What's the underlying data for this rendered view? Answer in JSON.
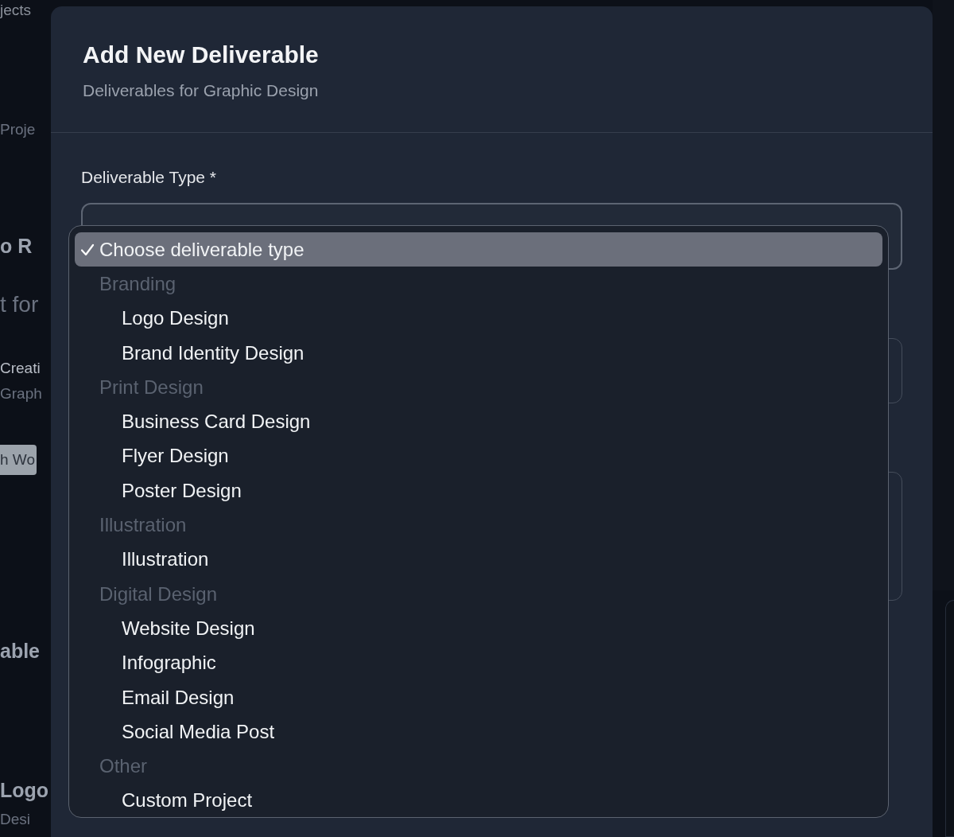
{
  "background": {
    "fragments": [
      {
        "text": "jects",
        "kind": "nav"
      },
      {
        "text": "Proje",
        "kind": "muted"
      },
      {
        "text": "o R",
        "kind": "heading"
      },
      {
        "text": "t for",
        "kind": "lead"
      },
      {
        "text": "Creati",
        "kind": "text"
      },
      {
        "text": "Graph",
        "kind": "muted"
      },
      {
        "text": "h Wo",
        "kind": "tag"
      },
      {
        "text": "able",
        "kind": "heading"
      },
      {
        "text": "Logo",
        "kind": "heading"
      },
      {
        "text": "Desi",
        "kind": "muted"
      }
    ]
  },
  "dialog": {
    "title": "Add New Deliverable",
    "subtitle": "Deliverables for Graphic Design",
    "field": {
      "label": "Deliverable Type *"
    },
    "dropdown": {
      "items": [
        {
          "kind": "option",
          "label": "Choose deliverable type",
          "selected": true
        },
        {
          "kind": "group",
          "label": "Branding"
        },
        {
          "kind": "option",
          "label": "Logo Design",
          "selected": false
        },
        {
          "kind": "option",
          "label": "Brand Identity Design",
          "selected": false
        },
        {
          "kind": "group",
          "label": "Print Design"
        },
        {
          "kind": "option",
          "label": "Business Card Design",
          "selected": false
        },
        {
          "kind": "option",
          "label": "Flyer Design",
          "selected": false
        },
        {
          "kind": "option",
          "label": "Poster Design",
          "selected": false
        },
        {
          "kind": "group",
          "label": "Illustration"
        },
        {
          "kind": "option",
          "label": "Illustration",
          "selected": false
        },
        {
          "kind": "group",
          "label": "Digital Design"
        },
        {
          "kind": "option",
          "label": "Website Design",
          "selected": false
        },
        {
          "kind": "option",
          "label": "Infographic",
          "selected": false
        },
        {
          "kind": "option",
          "label": "Email Design",
          "selected": false
        },
        {
          "kind": "option",
          "label": "Social Media Post",
          "selected": false
        },
        {
          "kind": "group",
          "label": "Other"
        },
        {
          "kind": "option",
          "label": "Custom Project",
          "selected": false
        }
      ]
    }
  }
}
